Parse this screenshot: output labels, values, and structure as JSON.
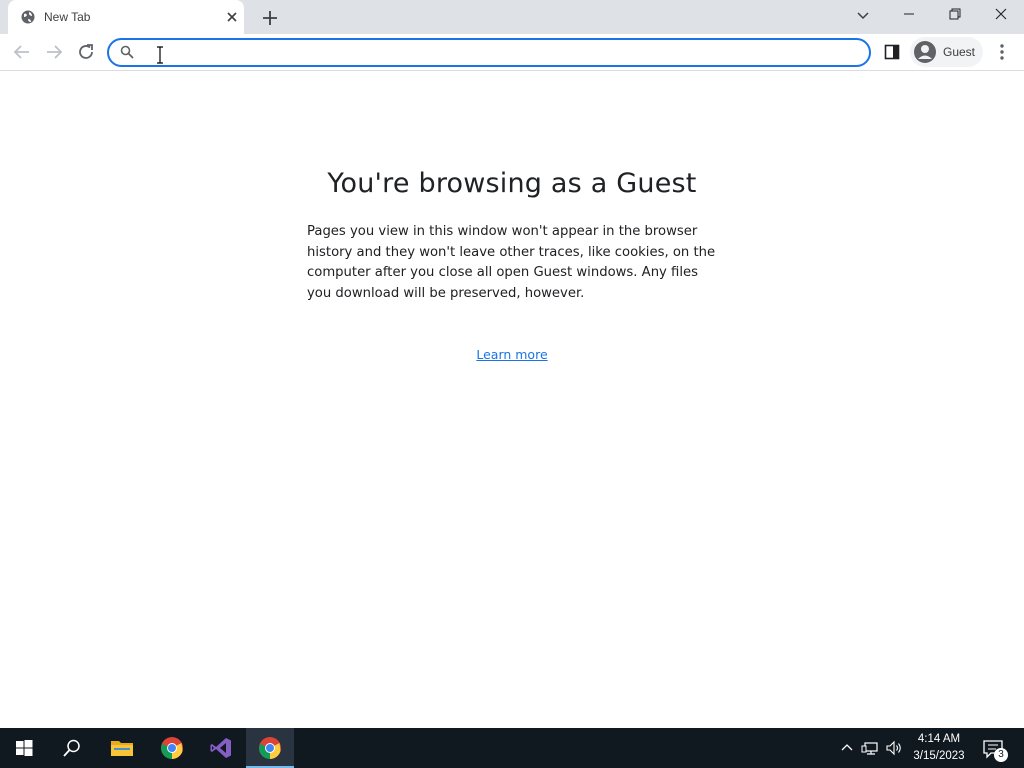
{
  "browser": {
    "tab": {
      "title": "New Tab"
    },
    "omnibox": {
      "value": "",
      "placeholder": ""
    },
    "profile": {
      "name": "Guest"
    }
  },
  "page": {
    "heading": "You're browsing as a Guest",
    "description": "Pages you view in this window won't appear in the browser history and they won't leave other traces, like cookies, on the computer after you close all open Guest windows. Any files you download will be preserved, however.",
    "link_label": "Learn more"
  },
  "taskbar": {
    "time": "4:14 AM",
    "date": "3/15/2023",
    "notification_count": "3",
    "icons": [
      "windows-start-icon",
      "search-icon",
      "file-explorer-icon",
      "chrome-icon",
      "visual-studio-icon",
      "chrome-icon"
    ]
  },
  "colors": {
    "accent": "#1a73e8",
    "tabstrip": "#dee1e6",
    "taskbar": "#101820",
    "text": "#202124"
  }
}
